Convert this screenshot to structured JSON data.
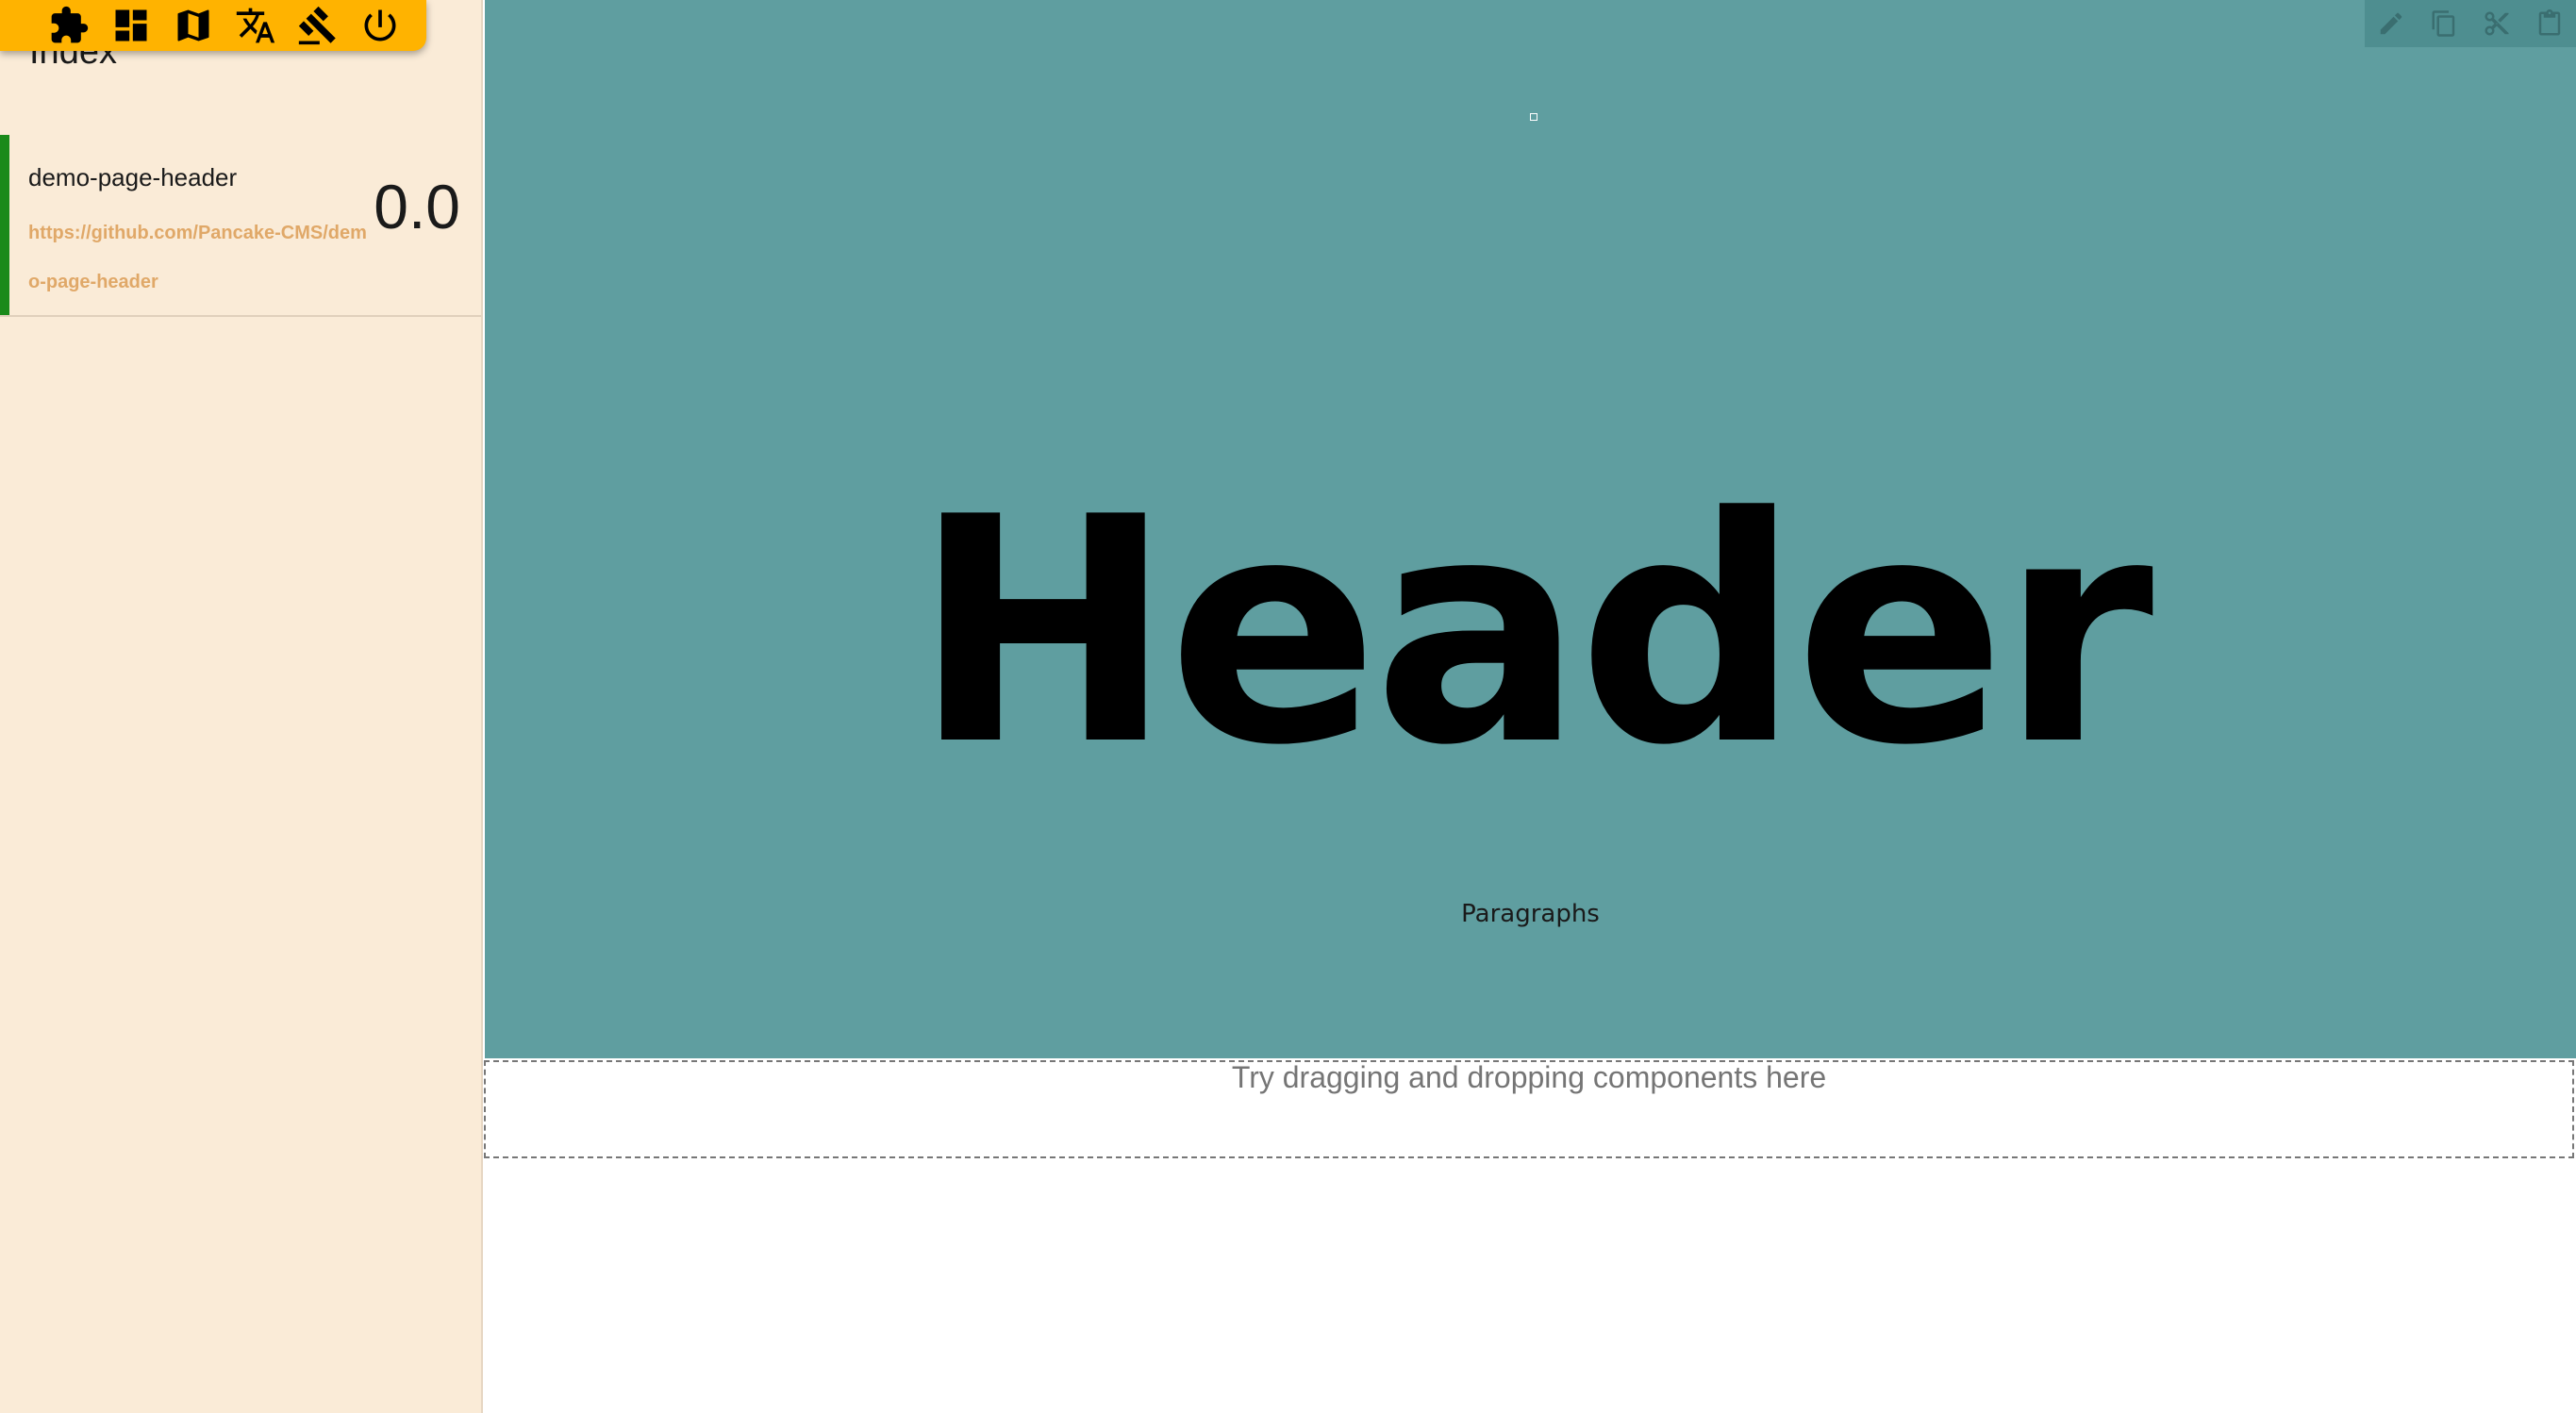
{
  "toolbar": {
    "icons": [
      "puzzle-icon",
      "dashboard-icon",
      "map-icon",
      "translate-icon",
      "gavel-icon",
      "power-icon"
    ]
  },
  "sidebar": {
    "title": "Index",
    "components": [
      {
        "name": "demo-page-header",
        "url": "https://github.com/Pancake-CMS/demo-page-header",
        "version": "0.0"
      }
    ]
  },
  "preview": {
    "title": "Header",
    "paragraph": "Paragraphs",
    "background_color": "#5f9ea0",
    "edit_tools": [
      "edit-icon",
      "copy-icon",
      "cut-icon",
      "paste-icon"
    ]
  },
  "drop_zone": {
    "hint": "Try dragging and dropping components here"
  },
  "colors": {
    "toolbar": "#ffb300",
    "sidebar_bg": "#faebd7",
    "component_marker": "#1a8a1a",
    "link": "#e0a868"
  }
}
